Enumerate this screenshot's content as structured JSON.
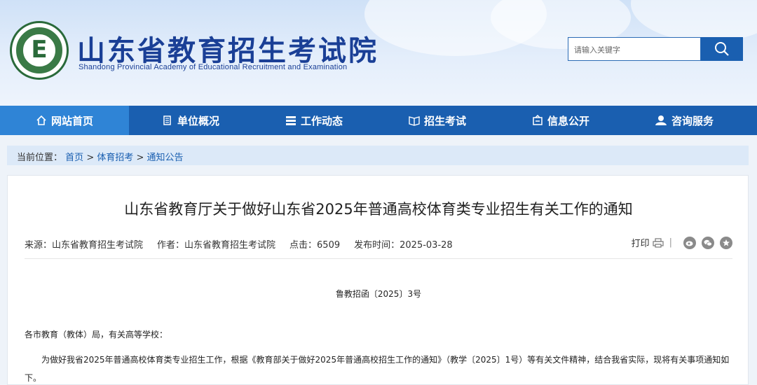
{
  "header": {
    "title": "山东省教育招生考试院",
    "subtitle": "Shandong Provincial Academy of Educational Recruitment and Examination",
    "logo_letter": "E",
    "search_placeholder": "请输入关键字"
  },
  "nav": {
    "items": [
      {
        "label": "网站首页",
        "icon": "home-icon"
      },
      {
        "label": "单位概况",
        "icon": "building-icon"
      },
      {
        "label": "工作动态",
        "icon": "list-icon"
      },
      {
        "label": "招生考试",
        "icon": "book-icon"
      },
      {
        "label": "信息公开",
        "icon": "info-icon"
      },
      {
        "label": "咨询服务",
        "icon": "user-service-icon"
      }
    ]
  },
  "breadcrumb": {
    "prefix": "当前位置：",
    "items": [
      "首页",
      "体育招考",
      "通知公告"
    ],
    "separator": " > "
  },
  "article": {
    "title": "山东省教育厅关于做好山东省2025年普通高校体育类专业招生有关工作的通知",
    "meta": {
      "source": "来源：山东省教育招生考试院",
      "author": "作者：山东省教育招生考试院",
      "clicks": "点击：6509",
      "date": "发布时间：2025-03-28"
    },
    "print_label": "打印",
    "doc_number": "鲁教招函〔2025〕3号",
    "greeting": "各市教育（教体）局，有关高等学校：",
    "body": "为做好我省2025年普通高校体育类专业招生工作，根据《教育部关于做好2025年普通高校招生工作的通知》（教学〔2025〕1号）等有关文件精神，结合我省实际，现将有关事项通知如下。"
  },
  "colors": {
    "nav_bg": "#1a5fb0",
    "nav_active": "#2f84d6",
    "title_blue": "#1a3f96",
    "link": "#1a5fb0"
  }
}
